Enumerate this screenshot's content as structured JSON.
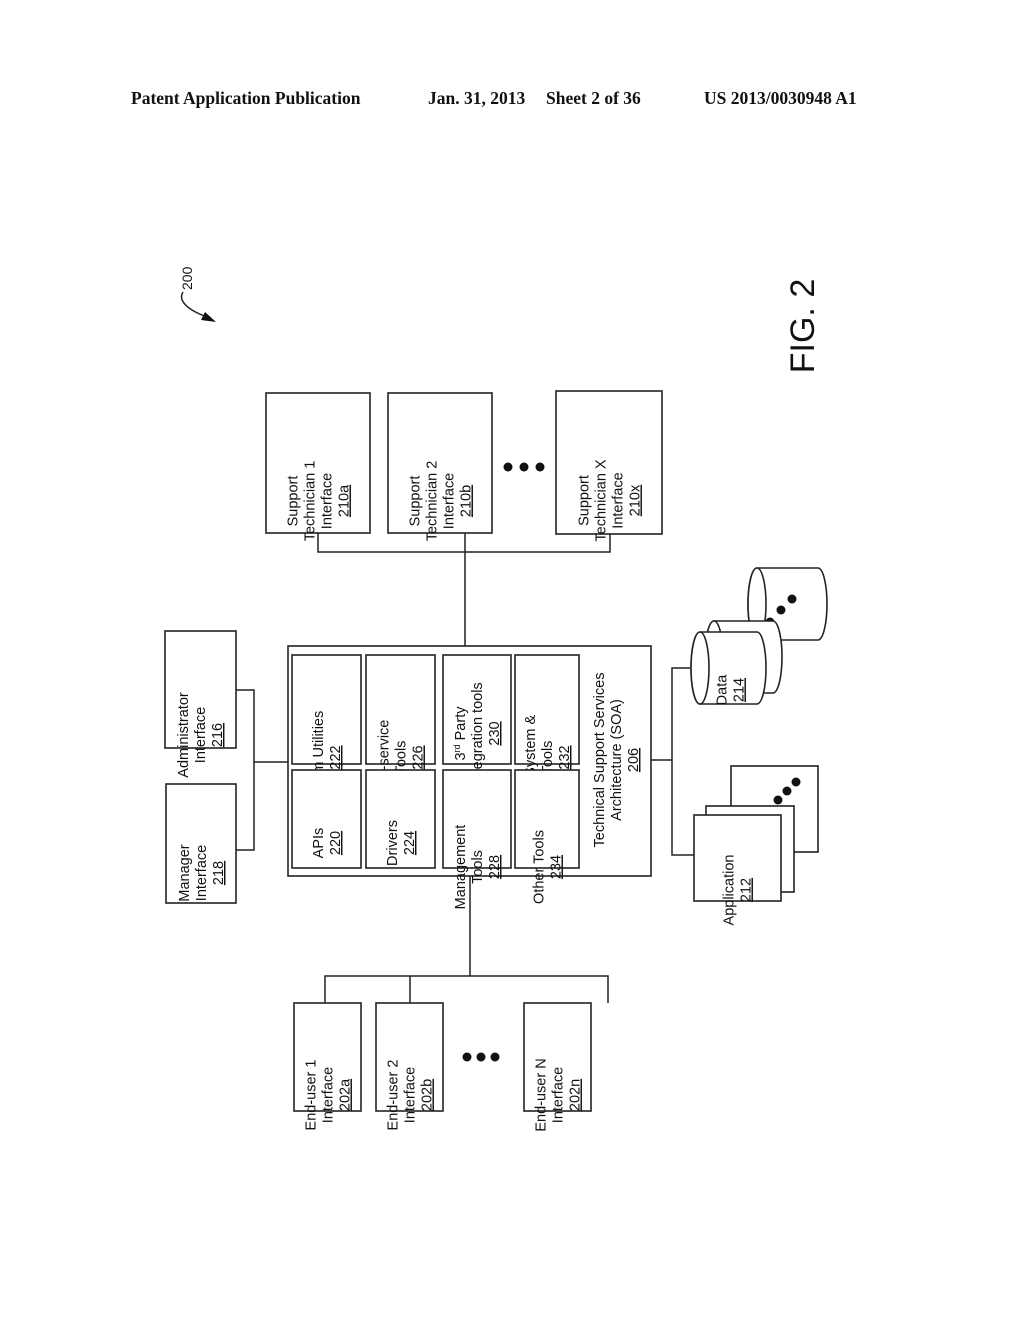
{
  "header": {
    "publication": "Patent Application Publication",
    "date": "Jan. 31, 2013",
    "sheet": "Sheet 2 of 36",
    "pub_number": "US 2013/0030948 A1"
  },
  "figure": {
    "label": "FIG. 2",
    "ref": "200",
    "support_technicians": [
      {
        "lines": [
          "Support",
          "Technician 1",
          "Interface"
        ],
        "ref": "210a"
      },
      {
        "lines": [
          "Support",
          "Technician 2",
          "Interface"
        ],
        "ref": "210b"
      },
      {
        "lines": [
          "Support",
          "Technician X",
          "Interface"
        ],
        "ref": "210x"
      }
    ],
    "administrator": {
      "lines": [
        "Administrator",
        "Interface"
      ],
      "ref": "216"
    },
    "manager": {
      "lines": [
        "Manager",
        "Interface"
      ],
      "ref": "218"
    },
    "soa": {
      "lines": [
        "Technical Support Services",
        "Architecture (SOA)"
      ],
      "ref": "206",
      "modules": [
        {
          "lines": [
            "Comm Utilities"
          ],
          "ref": "222"
        },
        {
          "lines": [
            "APIs"
          ],
          "ref": "220"
        },
        {
          "lines": [
            "Self-service",
            "Tools"
          ],
          "ref": "226"
        },
        {
          "lines": [
            "Drivers"
          ],
          "ref": "224"
        },
        {
          "lines": [
            "3rd Party",
            "integration tools"
          ],
          "ref": "230"
        },
        {
          "lines": [
            "Management",
            "Tools"
          ],
          "ref": "228"
        },
        {
          "lines": [
            "KB System &",
            "Tools"
          ],
          "ref": "232"
        },
        {
          "lines": [
            "Other Tools"
          ],
          "ref": "234"
        }
      ]
    },
    "data_store": {
      "lines": [
        "Data"
      ],
      "ref": "214"
    },
    "application": {
      "lines": [
        "Application"
      ],
      "ref": "212"
    },
    "end_users": [
      {
        "lines": [
          "End-user 1",
          "Interface"
        ],
        "ref": "202a"
      },
      {
        "lines": [
          "End-user 2",
          "Interface"
        ],
        "ref": "202b"
      },
      {
        "lines": [
          "End-user N",
          "Interface"
        ],
        "ref": "202n"
      }
    ],
    "ellipsis": "• • •"
  }
}
